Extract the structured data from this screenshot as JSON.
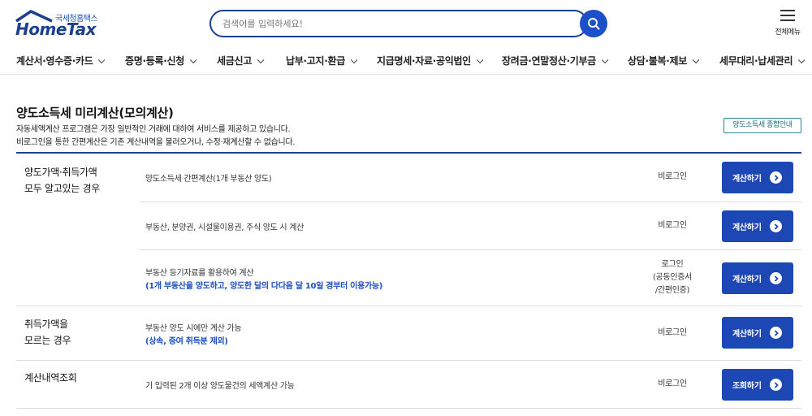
{
  "header": {
    "logo_sub": "국세청홈택스",
    "logo_main": "HomeTax",
    "search_placeholder": "검색어를 입력하세요!",
    "menu_all_label": "전체메뉴"
  },
  "nav": [
    {
      "label": "계산서·영수증·카드"
    },
    {
      "label": "증명·등록·신청"
    },
    {
      "label": "세금신고"
    },
    {
      "label": "납부·고지·환급"
    },
    {
      "label": "지급명세·자료·공익법인"
    },
    {
      "label": "장려금·연말정산·기부금"
    },
    {
      "label": "상담·불복·제보"
    },
    {
      "label": "세무대리·납세관리"
    }
  ],
  "page": {
    "title": "양도소득세 미리계산(모의계산)",
    "desc1": "자동세액계산 프로그램은 가장 일반적인 거래에 대하여 서비스를 제공하고 있습니다.",
    "desc2": "비로그인을 통한 간편계산은 기존 계산내역을 불러오거나, 수정·재계산할 수 없습니다.",
    "guide_button": "양도소득세 종합안내"
  },
  "sections": [
    {
      "category": [
        "양도가액·취득가액",
        "모두 알고있는 경우"
      ],
      "items": [
        {
          "text": "양도소득세 간편계산(1개 부동산 양도)",
          "note": "",
          "auth": [
            "비로그인"
          ],
          "button": "계산하기"
        },
        {
          "text": "부동산, 분양권, 시설물이용권, 주식 양도 시 계산",
          "note": "",
          "auth": [
            "비로그인"
          ],
          "button": "계산하기"
        },
        {
          "text": "부동산 등기자료를 활용하여 계산",
          "note": "(1개 부동산을 양도하고, 양도한 달의 다다음 달 10일 경부터 이용가능)",
          "auth": [
            "로그인",
            "(공동인증서",
            "/간편인증)"
          ],
          "button": "계산하기"
        }
      ]
    },
    {
      "category": [
        "취득가액을",
        "모르는 경우"
      ],
      "items": [
        {
          "text": "부동산 양도 시에만 계산 가능",
          "note": "(상속, 증여 취득분 제외)",
          "auth": [
            "비로그인"
          ],
          "button": "계산하기"
        }
      ]
    },
    {
      "category": [
        "계산내역조회"
      ],
      "items": [
        {
          "text": "기 입력된 2개 이상 양도물건의 세액계산 가능",
          "note": "",
          "auth": [
            "비로그인"
          ],
          "button": "조회하기"
        }
      ]
    }
  ]
}
